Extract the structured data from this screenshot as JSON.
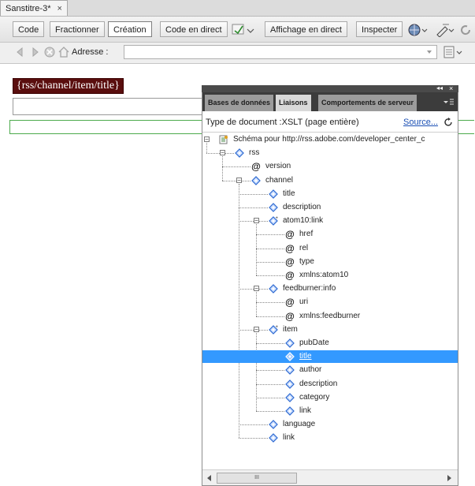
{
  "document_tab": {
    "title": "Sanstitre-3*",
    "close": "×"
  },
  "toolbar": {
    "code": "Code",
    "split": "Fractionner",
    "design": "Création",
    "live_code": "Code en direct",
    "live_view": "Affichage en direct",
    "inspect": "Inspecter"
  },
  "address_bar": {
    "label": "Adresse :",
    "value": ""
  },
  "design_view": {
    "dynamic_text": "{rss/channel/item/title}"
  },
  "panel": {
    "collapse": "◂◂",
    "close": "×",
    "tabs": [
      "Bases de données",
      "Liaisons",
      "Comportements de serveur"
    ],
    "active_tab": "Liaisons",
    "document_type": "Type de document :XSLT (page entière)",
    "source_link": "Source...",
    "tree": [
      {
        "label": "Schéma pour http://rss.adobe.com/developer_center_c",
        "type": "schema",
        "level": 0
      },
      {
        "label": "rss",
        "type": "element",
        "level": 1
      },
      {
        "label": "version",
        "type": "attribute",
        "level": 2
      },
      {
        "label": "channel",
        "type": "element",
        "level": 2
      },
      {
        "label": "title",
        "type": "element",
        "level": 3
      },
      {
        "label": "description",
        "type": "element",
        "level": 3
      },
      {
        "label": "atom10:link",
        "type": "element-repeat",
        "level": 3
      },
      {
        "label": "href",
        "type": "attribute",
        "level": 4
      },
      {
        "label": "rel",
        "type": "attribute",
        "level": 4
      },
      {
        "label": "type",
        "type": "attribute",
        "level": 4
      },
      {
        "label": "xmlns:atom10",
        "type": "attribute",
        "level": 4
      },
      {
        "label": "feedburner:info",
        "type": "element",
        "level": 3
      },
      {
        "label": "uri",
        "type": "attribute",
        "level": 4
      },
      {
        "label": "xmlns:feedburner",
        "type": "attribute",
        "level": 4
      },
      {
        "label": "item",
        "type": "element-repeat",
        "level": 3
      },
      {
        "label": "pubDate",
        "type": "element",
        "level": 4
      },
      {
        "label": "title",
        "type": "element",
        "level": 4,
        "selected": true
      },
      {
        "label": "author",
        "type": "element",
        "level": 4
      },
      {
        "label": "description",
        "type": "element",
        "level": 4
      },
      {
        "label": "category",
        "type": "element",
        "level": 4
      },
      {
        "label": "link",
        "type": "element",
        "level": 4
      },
      {
        "label": "language",
        "type": "element",
        "level": 3
      },
      {
        "label": "link",
        "type": "element",
        "level": 3
      }
    ],
    "scroll_thumb": "III"
  },
  "colors": {
    "selection": "#3399ff",
    "dynamic_text_bg": "#5a0e0e",
    "guide_green": "#4caa4c",
    "link_blue": "#1a4fb4"
  }
}
